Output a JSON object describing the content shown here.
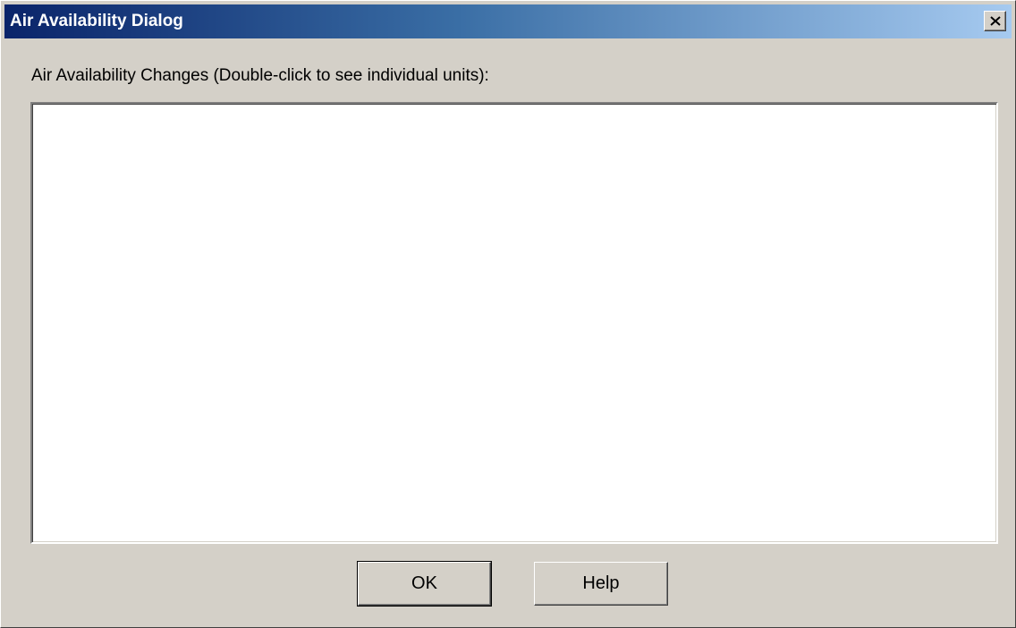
{
  "window": {
    "title": "Air Availability Dialog",
    "close_label": "×"
  },
  "dialog": {
    "list_label": "Air Availability Changes (Double-click to see individual units):",
    "list_items": []
  },
  "buttons": {
    "ok_label": "OK",
    "help_label": "Help"
  },
  "colors": {
    "title_gradient_start": "#0a246a",
    "title_gradient_end": "#a6caf0",
    "face": "#d4d0c8",
    "list_background": "#ffffff"
  },
  "icons": {
    "close": "close-icon"
  }
}
